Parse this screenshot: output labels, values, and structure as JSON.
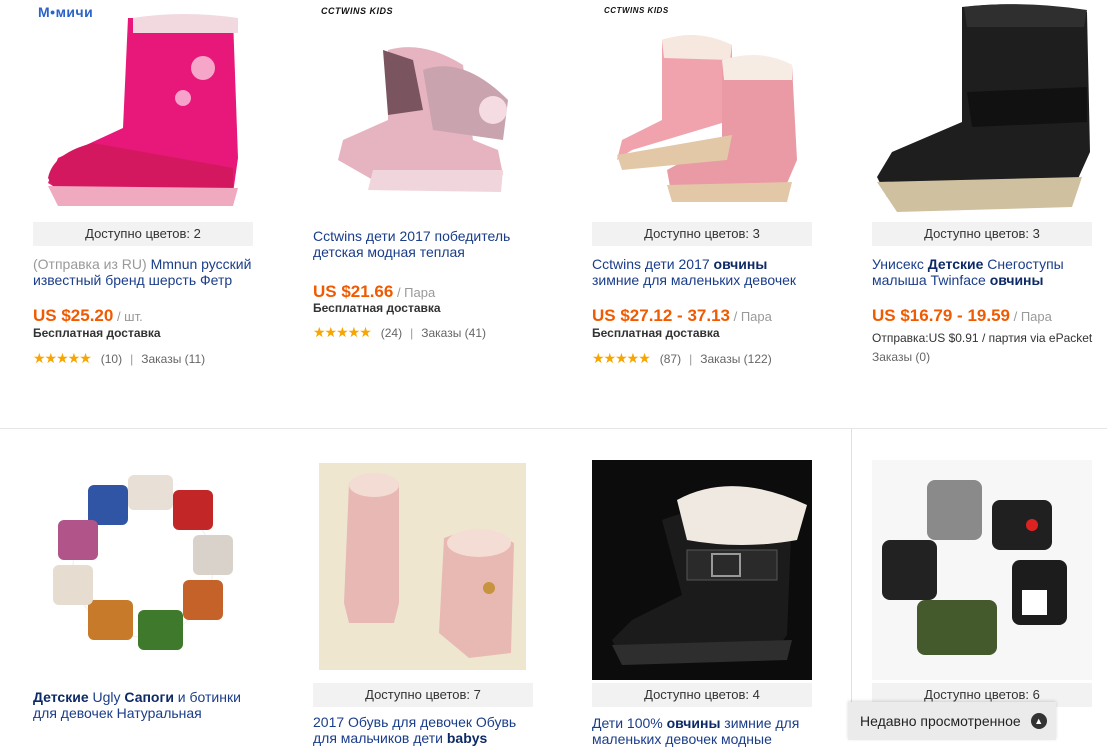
{
  "products": [
    {
      "brand": "М•мичи",
      "colors": "Доступно цветов: 2",
      "title_muted": "(Отправка из RU)",
      "title": " Mmnun русский известный бренд шерсть Фетр",
      "price": "US $25.20",
      "unit": " / шт.",
      "shipping": "Бесплатная доставка",
      "stars": "★★★★★",
      "reviews": "(10)",
      "orders": "Заказы (11)"
    },
    {
      "brand": "CCTWINS KIDS",
      "title": "Cctwins дети 2017 победитель детская модная теплая",
      "price": "US $21.66",
      "unit": " / Пара",
      "shipping": "Бесплатная доставка",
      "stars": "★★★★★",
      "reviews": "(24)",
      "orders": "Заказы (41)"
    },
    {
      "brand": "CCTWINS KIDS",
      "colors": "Доступно цветов: 3",
      "title_a": "Cctwins дети 2017 ",
      "title_b": "овчины",
      "title_c": " зимние для маленьких девочек",
      "price": "US $27.12 - 37.13",
      "unit": " / Пара",
      "shipping": "Бесплатная доставка",
      "stars": "★★★★★",
      "reviews": "(87)",
      "orders": "Заказы (122)"
    },
    {
      "colors": "Доступно цветов: 3",
      "title_a": "Унисекс ",
      "title_b": "Детские",
      "title_c": " Снегоступы малыша Twinface ",
      "title_d": "овчины",
      "price": "US $16.79 - 19.59",
      "unit": " / Пара",
      "shipping": "Отправка:US $0.91 / партия via ePacket",
      "orders": "Заказы (0)"
    },
    {
      "title_a": "Детские",
      "title_b": " Ugly ",
      "title_c": "Сапоги",
      "title_d": " и ботинки для девочек Натуральная"
    },
    {
      "colors": "Доступно цветов: 7",
      "title_a": "2017 Обувь для девочек Обувь для мальчиков дети ",
      "title_b": "babys"
    },
    {
      "colors": "Доступно цветов: 4",
      "title_a": "Дети 100% ",
      "title_b": "овчины",
      "title_c": " зимние для маленьких девочек модные"
    },
    {
      "colors": "Доступно цветов: 6"
    }
  ],
  "recently_viewed": "Недавно просмотренное",
  "colors": {
    "price": "#f05a00",
    "link": "#1a3d8a",
    "star": "#f7a500"
  }
}
